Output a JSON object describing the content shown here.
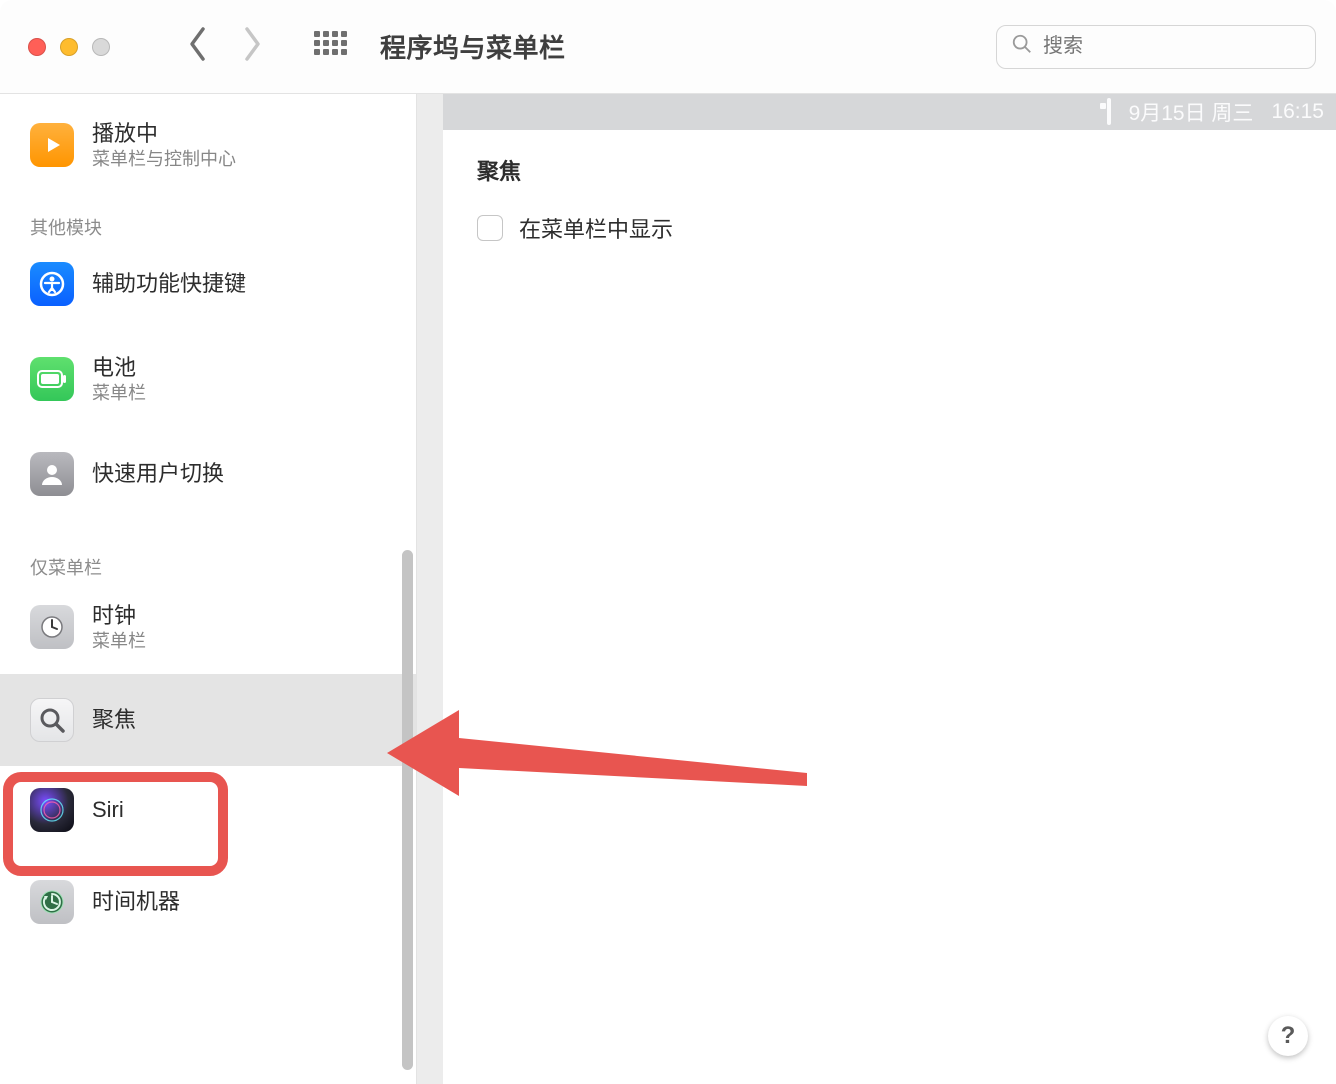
{
  "toolbar": {
    "title": "程序坞与菜单栏",
    "search_placeholder": "搜索"
  },
  "sidebar": {
    "items": [
      {
        "primary": "播放中",
        "secondary": "菜单栏与控制中心"
      }
    ],
    "section_other": "其他模块",
    "other_items": [
      {
        "primary": "辅助功能快捷键",
        "secondary": ""
      },
      {
        "primary": "电池",
        "secondary": "菜单栏"
      },
      {
        "primary": "快速用户切换",
        "secondary": ""
      }
    ],
    "section_menubar_only": "仅菜单栏",
    "menubar_items": [
      {
        "primary": "时钟",
        "secondary": "菜单栏"
      },
      {
        "primary": "聚焦",
        "secondary": ""
      },
      {
        "primary": "Siri",
        "secondary": ""
      },
      {
        "primary": "时间机器",
        "secondary": ""
      }
    ]
  },
  "menubar_preview": {
    "date": "9月15日 周三",
    "time": "16:15"
  },
  "panel": {
    "title": "聚焦",
    "checkbox_label": "在菜单栏中显示"
  },
  "help": "?"
}
